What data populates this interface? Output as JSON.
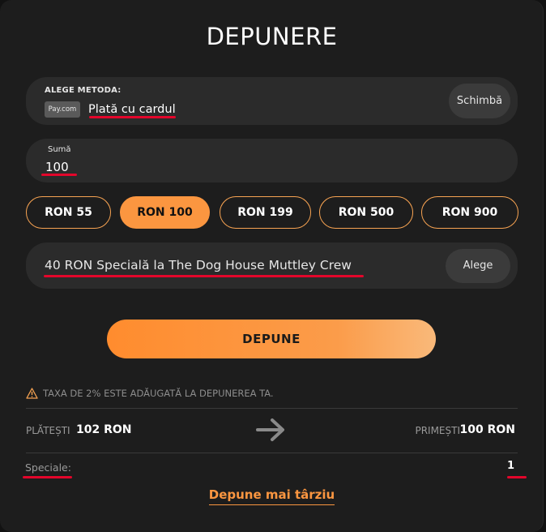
{
  "title": "DEPUNERE",
  "method": {
    "label": "ALEGE METODA:",
    "logo_text": "Pay.com",
    "value": "Plată cu cardul",
    "change_label": "Schimbă"
  },
  "amount": {
    "label": "Sumă",
    "value": "100"
  },
  "chips": [
    "RON 55",
    "RON 100",
    "RON 199",
    "RON 500",
    "RON 900"
  ],
  "selected_chip": "RON 100",
  "bonus": {
    "value": "40 RON Specială la The Dog House Muttley Crew",
    "choose_label": "Alege"
  },
  "deposit_button": "DEPUNE",
  "fee_notice": "TAXA DE 2% ESTE ADĂUGATĂ LA DEPUNEREA TA.",
  "summary": {
    "pay_label": "PLĂTEȘTI",
    "pay_value": "102 RON",
    "receive_label": "PRIMEȘTI",
    "receive_value": "100 RON"
  },
  "specials": {
    "label": "Speciale:",
    "value": "1"
  },
  "later_link": "Depune mai târziu",
  "colors": {
    "accent": "#fb9640",
    "annotation": "#e3062b",
    "background": "#1d1d1d"
  }
}
